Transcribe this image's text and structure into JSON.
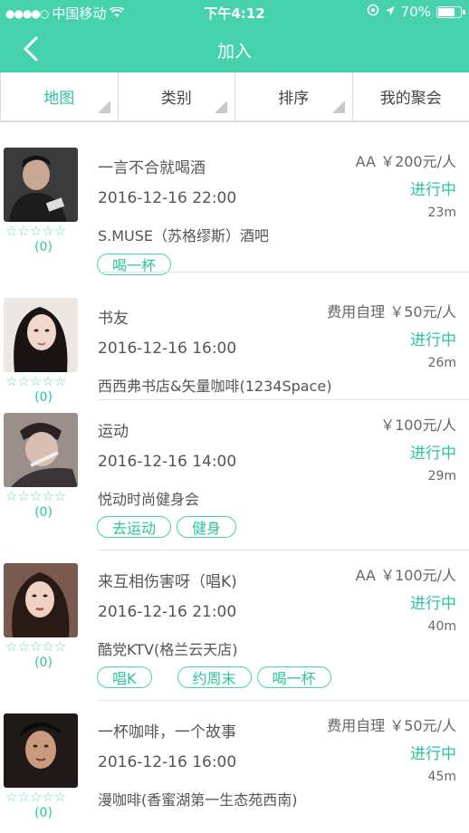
{
  "status_bar": {
    "carrier": "中国移动",
    "time": "下午4:12",
    "battery": "70%"
  },
  "header": {
    "title": "加入"
  },
  "filters": [
    {
      "label": "地图",
      "active": true
    },
    {
      "label": "类别",
      "active": false
    },
    {
      "label": "排序",
      "active": false
    },
    {
      "label": "我的聚会",
      "active": false
    }
  ],
  "events": [
    {
      "name": "一言不合就喝酒",
      "time": "2016-12-16 22:00",
      "venue": "S.MUSE（苏格缪斯）酒吧",
      "price": "AA ￥200元/人",
      "status": "进行中",
      "distance": "23m",
      "stars": "☆☆☆☆☆",
      "score": "(0)",
      "tags": [
        "喝一杯"
      ]
    },
    {
      "name": "书友",
      "time": "2016-12-16 16:00",
      "venue": "西西弗书店&矢量咖啡(1234Space)",
      "price": "费用自理 ￥50元/人",
      "status": "进行中",
      "distance": "26m",
      "stars": "☆☆☆☆☆",
      "score": "(0)",
      "tags": []
    },
    {
      "name": "运动",
      "time": "2016-12-16 14:00",
      "venue": "悦动时尚健身会",
      "price": "￥100元/人",
      "status": "进行中",
      "distance": "29m",
      "stars": "☆☆☆☆☆",
      "score": "(0)",
      "tags": [
        "去运动",
        "健身"
      ]
    },
    {
      "name": "来互相伤害呀（唱K)",
      "time": "2016-12-16 21:00",
      "venue": "酷党KTV(格兰云天店)",
      "price": "AA ￥100元/人",
      "status": "进行中",
      "distance": "40m",
      "stars": "☆☆☆☆☆",
      "score": "(0)",
      "tags": [
        "唱K",
        "约周末",
        "喝一杯"
      ]
    },
    {
      "name": "一杯咖啡，一个故事",
      "time": "2016-12-16 16:00",
      "venue": "漫咖啡(香蜜湖第一生态苑西南)",
      "price": "费用自理 ￥50元/人",
      "status": "进行中",
      "distance": "45m",
      "stars": "☆☆☆☆☆",
      "score": "(0)",
      "tags": []
    }
  ]
}
